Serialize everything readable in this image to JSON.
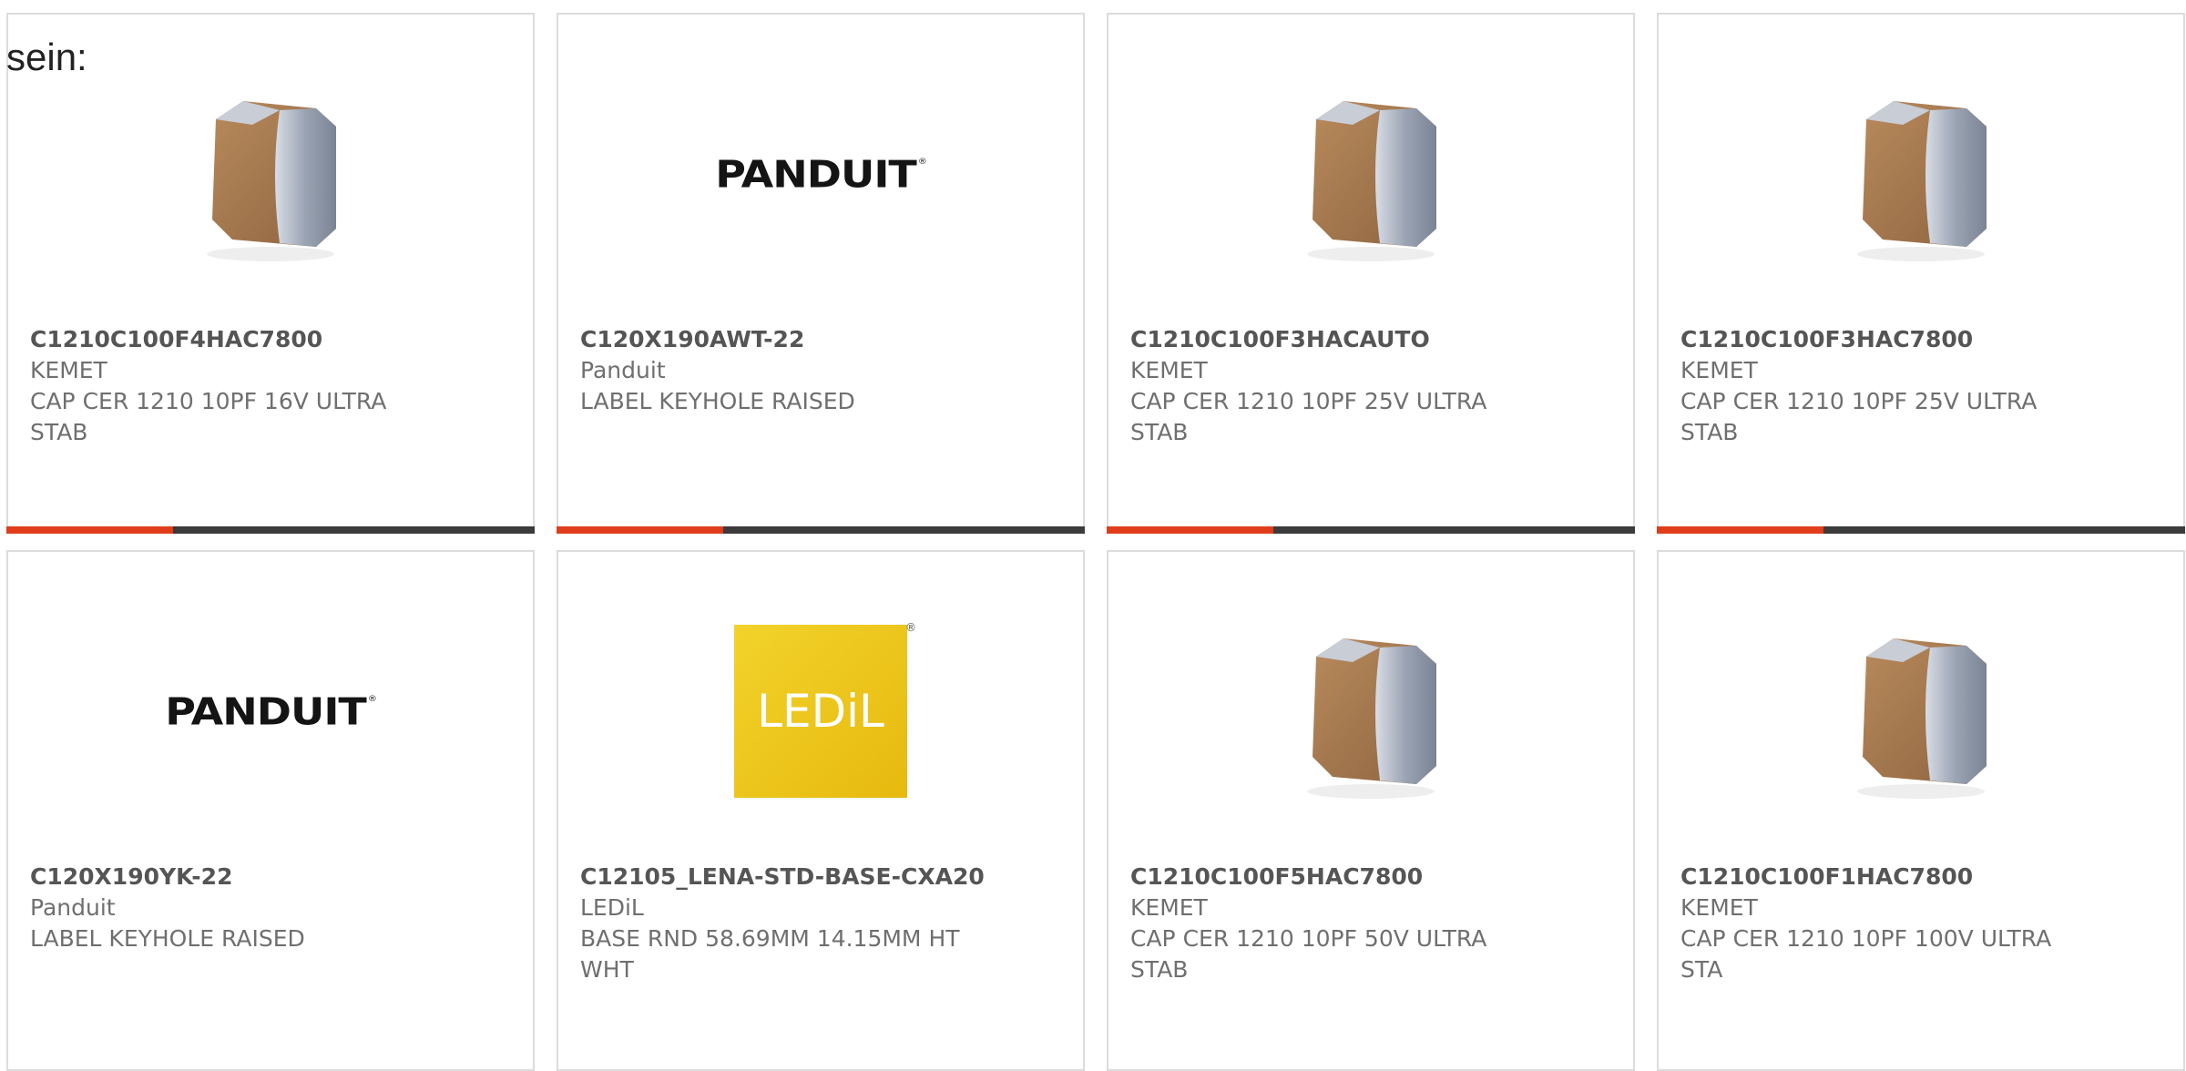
{
  "stray_text": "sein:",
  "colors": {
    "accent": "#e03e1a",
    "bar": "#3b3b3b",
    "card_border": "#dcdcdc",
    "text": "#6f6f6f"
  },
  "cards": [
    {
      "part_number": "C1210C100F4HAC7800",
      "manufacturer": "KEMET",
      "description": "CAP CER 1210 10PF 16V ULTRA\nSTAB",
      "image": "capacitor-image"
    },
    {
      "part_number": "C120X190AWT-22",
      "manufacturer": "Panduit",
      "description": "LABEL KEYHOLE RAISED",
      "image": "panduit-logo",
      "logo_text": "PANDUIT"
    },
    {
      "part_number": "C1210C100F3HACAUTO",
      "manufacturer": "KEMET",
      "description": "CAP CER 1210 10PF 25V ULTRA\nSTAB",
      "image": "capacitor-image"
    },
    {
      "part_number": "C1210C100F3HAC7800",
      "manufacturer": "KEMET",
      "description": "CAP CER 1210 10PF 25V ULTRA\nSTAB",
      "image": "capacitor-image"
    },
    {
      "part_number": "C120X190YK-22",
      "manufacturer": "Panduit",
      "description": "LABEL KEYHOLE RAISED",
      "image": "panduit-logo",
      "logo_text": "PANDUIT"
    },
    {
      "part_number": "C12105_LENA-STD-BASE-CXA20",
      "manufacturer": "LEDiL",
      "description": "BASE RND 58.69MM 14.15MM HT\nWHT",
      "image": "ledil-logo",
      "logo_text": "LEDiL"
    },
    {
      "part_number": "C1210C100F5HAC7800",
      "manufacturer": "KEMET",
      "description": "CAP CER 1210 10PF 50V ULTRA\nSTAB",
      "image": "capacitor-image"
    },
    {
      "part_number": "C1210C100F1HAC7800",
      "manufacturer": "KEMET",
      "description": "CAP CER 1210 10PF 100V ULTRA\nSTA",
      "image": "capacitor-image"
    }
  ]
}
